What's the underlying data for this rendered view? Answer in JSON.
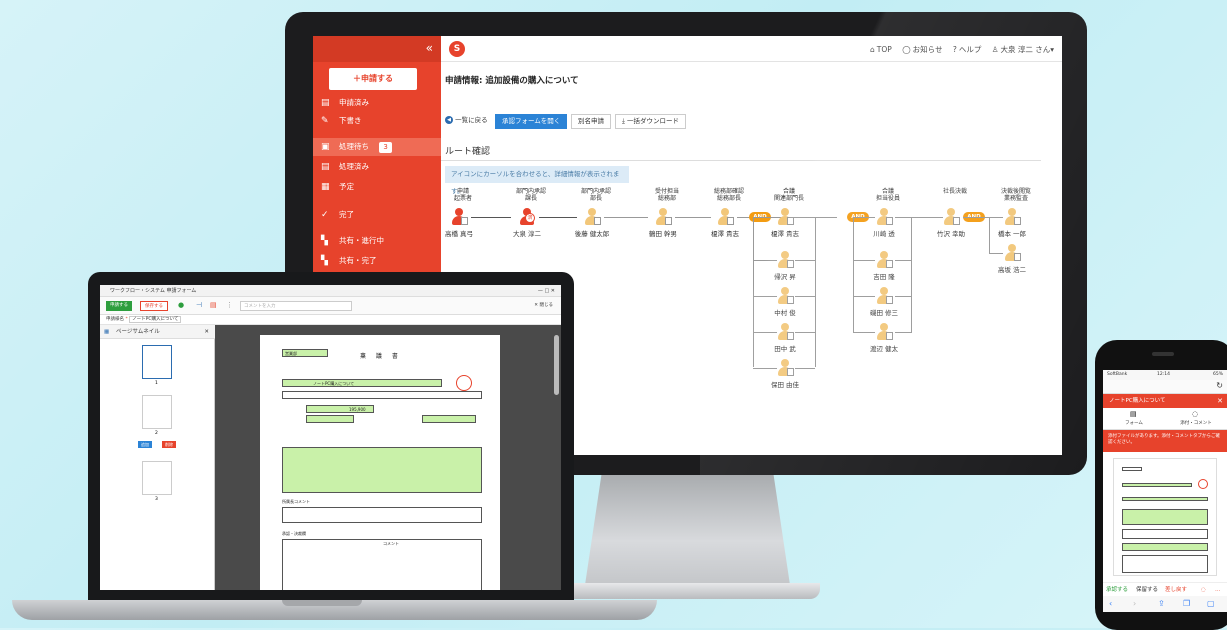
{
  "desktop": {
    "sidebar": {
      "collapse_icon": "«",
      "apply_button": "＋申請する",
      "items": [
        {
          "label": "申請済み",
          "icon": "document-icon"
        },
        {
          "label": "下書き",
          "icon": "pencil-icon"
        },
        {
          "label": "処理待ち",
          "icon": "inbox-icon",
          "badge": "3"
        },
        {
          "label": "処理済み",
          "icon": "check-doc-icon"
        },
        {
          "label": "予定",
          "icon": "schedule-icon"
        },
        {
          "label": "完了",
          "icon": "check-icon"
        },
        {
          "label": "共有・進行中",
          "icon": "share-icon"
        },
        {
          "label": "共有・完了",
          "icon": "share-done-icon"
        }
      ]
    },
    "header": {
      "logo": "S",
      "nav": [
        "TOP",
        "お知らせ",
        "ヘルプ",
        "大泉 淳二 さん▾"
      ]
    },
    "page_title": "申請情報: 追加設備の購入について",
    "buttons": {
      "back": "一覧に戻る",
      "open_form": "承認フォームを開く",
      "alias": "別名申請",
      "download": "一括ダウンロード"
    },
    "route_title": "ルート確認",
    "hint": "アイコンにカーソルを合わせると、詳細情報が表示されます。",
    "route": {
      "roles": [
        "申請\n起票者",
        "部門内承認\n課長",
        "部門内承認\n部長",
        "受付担当\n総務部",
        "総務部確認\n総務部長",
        "合議\n関連部門長",
        "合議\n担当役員",
        "社長決裁",
        "決裁後閲覧\n業務監査"
      ],
      "people": [
        "高橋 真弓",
        "大泉 淳二",
        "後藤 健太郎",
        "鶴田 幹男",
        "榎澤 貴志",
        "榎澤 貴志",
        "帰沢 昇",
        "中村 俊",
        "田中 武",
        "保田 由佳",
        "川崎 透",
        "吉田 隆",
        "磯田 修三",
        "渡辺 健太",
        "竹沢 幸助",
        "橋本 一郎",
        "高坂 浩二"
      ],
      "and_label": "AND",
      "stamp": "済"
    },
    "colors": {
      "accent": "#e7432c",
      "and": "#f39c12"
    }
  },
  "laptop": {
    "title": "ワークフロー・システム 申請フォーム",
    "toolbar": {
      "apply": "申請する",
      "save": "保存する",
      "comment_placeholder": "コメントを入力",
      "close": "閉じる"
    },
    "form_name_label": "申請様名",
    "form_name": "ノートPC購入について",
    "thumbs_title": "ページサムネイル",
    "thumb_pages": [
      "1",
      "2",
      "3"
    ],
    "thumb_buttons": [
      "追加",
      "削除"
    ],
    "doc": {
      "title": "稟 議 書",
      "dept": "営業部",
      "subject": "ノートPC購入について",
      "amount": "195,900",
      "comment_heading": "所属長コメント",
      "approval_heading": "承認・決裁欄",
      "comment_col": "コメント"
    }
  },
  "phone": {
    "status_left": "SoftBank",
    "status_time": "12:14",
    "status_right": "65%",
    "title": "ノートPC購入について",
    "close": "閉じる",
    "tabs": [
      "フォーム",
      "添付・コメント"
    ],
    "notice": "添付ファイルがあります。添付・コメントタブからご確認ください。",
    "actions": [
      "承認する",
      "保留する",
      "差し戻す"
    ]
  }
}
